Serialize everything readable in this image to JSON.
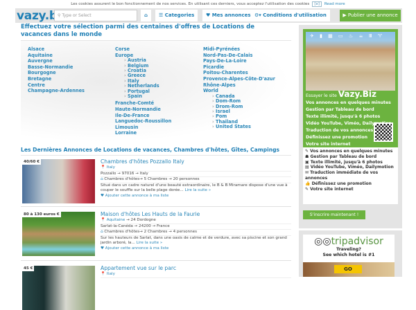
{
  "cookie": {
    "text": "Les cookies assurent le bon fonctionnement de nos services. En utilisant ces derniers, vous acceptez l'utilisation des cookies",
    "close": "[x]",
    "read_more": "Read more"
  },
  "nav": {
    "logo": "vazy.biz",
    "search_placeholder": "Type or Select",
    "home": "⌂",
    "categories": "☰ Categories",
    "favorites": "♥ Mes annonces",
    "conditions": "⚙▾ Conditions d'utilisation",
    "publish": "▶ Publier une annonce"
  },
  "regions": {
    "title": "Effectuez votre sélection parmi des centaines d'offres de Locations de vacances dans le monde",
    "col1": [
      "Alsace",
      "Aquitaine",
      "Auvergne",
      "Basse-Normandie",
      "Bourgogne",
      "Bretagne",
      "Centre",
      "Champagne-Ardennes"
    ],
    "col2a": [
      "Corse",
      "Europe"
    ],
    "europe": [
      "Austria",
      "Belgium",
      "Croatia",
      "Greece",
      "Italy",
      "Netherlands",
      "Portugal",
      "Spain"
    ],
    "col2b": [
      "Franche-Comté",
      "Haute-Normandie",
      "Ile-De-France",
      "Languedoc-Roussillon",
      "Limousin",
      "Lorraine"
    ],
    "col3": [
      "Midi-Pyrénées",
      "Nord-Pas-De-Calais",
      "Pays-De-La-Loire",
      "Picardie",
      "Poitou-Charentes",
      "Provence-Alpes-Côte-D'azur",
      "Rhône-Alpes",
      "World"
    ],
    "world": [
      "Canada",
      "Dom-Rom",
      "Drom-Rom",
      "Israel",
      "Pom",
      "Thailand",
      "United States"
    ]
  },
  "listings": {
    "title": "Les Dernières Annonces de Locations de vacances, Chambres d'hôtes, Gîtes, Campings",
    "items": [
      {
        "price": "40/60 €",
        "title": "Chambres d'hôtes Pozzallo Italy",
        "region": "Italy",
        "region_extra": "",
        "address": "Pozzallo ➞ 97016 ➞ Italy",
        "type": "Chambres d'hôtes→ 5 Chambres → 20 personnes",
        "desc": "Situé dans un cadre naturel d'une beauté extraordinaire, le B & B Miramare dispose d'une vue à couper le souffle sur la belle plage dorée...",
        "more": "Lire la suite »",
        "fav": "Ajouter cette annonce à ma liste"
      },
      {
        "price": "80 à 130 euros €",
        "title": "Maison d'hôtes Les Hauts de la Faurie",
        "region": "Aquitaine",
        "region_extra": " → 24 Dordogne",
        "address": "Sarlat-la-Canéda ➞ 24200 ➞ France",
        "type": "Chambres d'hôtes→ 2 Chambres → 4 personnes",
        "desc": "Sur les hauteurs de Sarlat, dans une oasis de calme et de verdure, avec sa piscine et son grand jardin arboré, la...",
        "more": "Lire la suite »",
        "fav": "Ajouter cette annonce à ma liste"
      },
      {
        "price": "45 €",
        "title": "Appartement vue sur le parc",
        "region": "Italy",
        "region_extra": ""
      }
    ]
  },
  "sidebar": {
    "ad": {
      "try": "Essayer le site ",
      "brand": "Vazy.Biz",
      "lines": [
        "Vos annonces en quelques minutes",
        "Gestion par Tableau de bord",
        "Texte illimité, jusqu'à 6 photos",
        "Vidéo YouTube, Viméo, Dailymotion",
        "Traduction de vos annonces",
        "Définissez une promotion",
        "Votre site internet"
      ]
    },
    "features": [
      "Vos annonces en quelques minutes",
      "Gestion par Tableau de bord",
      "Texte illimité, jusqu'à 6 photos",
      "Vidéo YouTube, Viméo, Dailymotion",
      "Traduction immédiate de vos annonces",
      "Définissez une promotion",
      "Votre site internet"
    ],
    "signup": "S'inscrire maintenant !",
    "trip": {
      "logo_a": "trip",
      "logo_b": "advisor",
      "line1": "Traveling?",
      "line2": "See which hotel is #1",
      "go": "GO"
    }
  }
}
